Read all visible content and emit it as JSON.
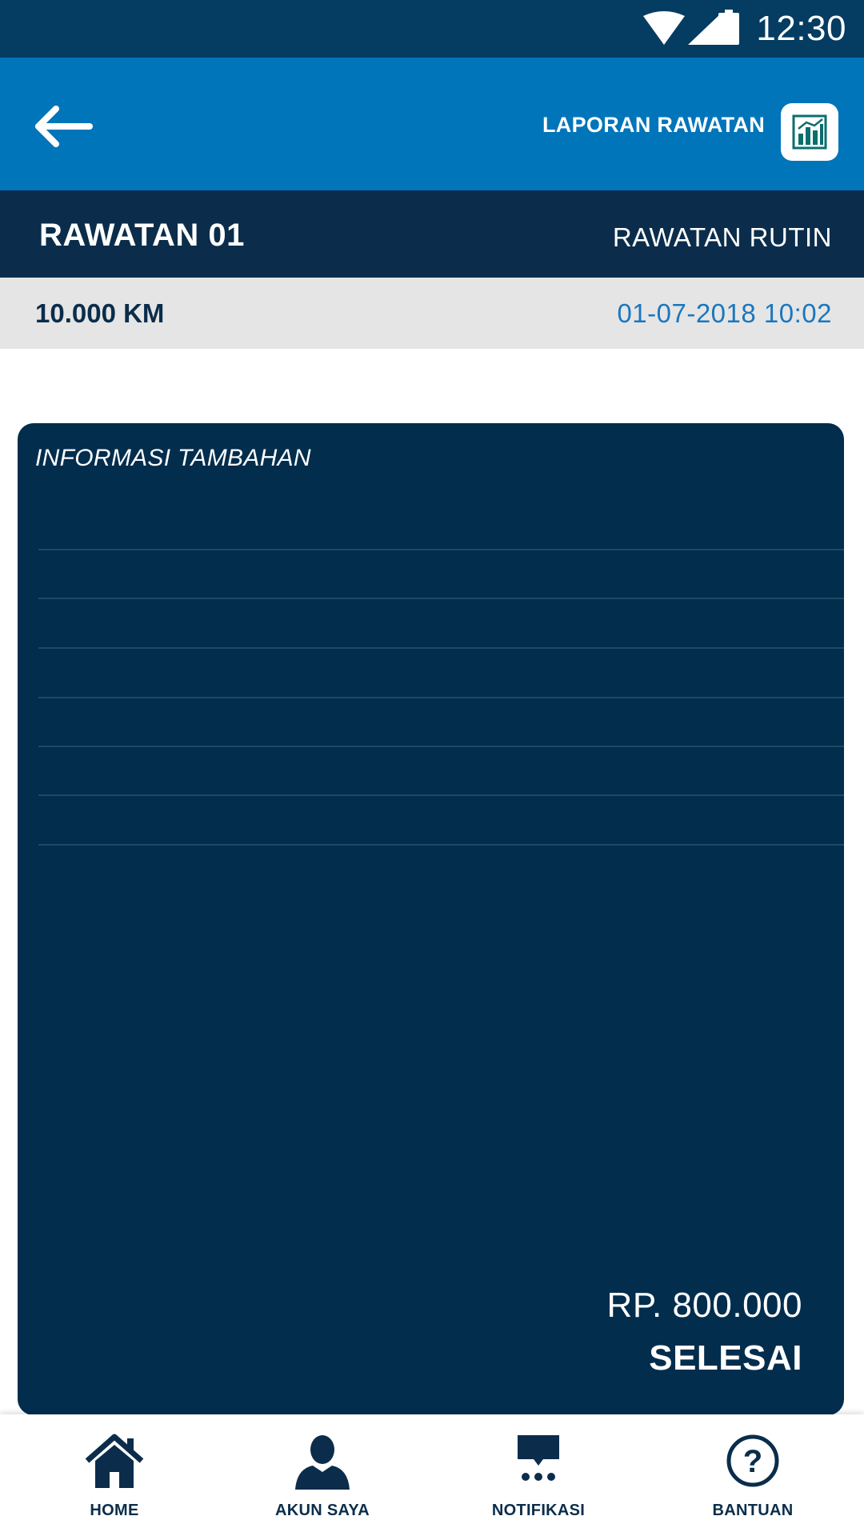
{
  "status_bar": {
    "time": "12:30"
  },
  "app_bar": {
    "report_label": "LAPORAN RAWATAN"
  },
  "header": {
    "title": "RAWATAN 01",
    "type": "RAWATAN RUTIN"
  },
  "info": {
    "mileage": "10.000 KM",
    "datetime": "01-07-2018 10:02"
  },
  "card": {
    "heading": "INFORMASI TAMBAHAN",
    "price": "RP. 800.000",
    "status": "SELESAI"
  },
  "bottom_nav": {
    "items": [
      {
        "label": "HOME",
        "icon": "home-icon"
      },
      {
        "label": "AKUN SAYA",
        "icon": "user-icon"
      },
      {
        "label": "NOTIFIKASI",
        "icon": "chat-icon"
      },
      {
        "label": "BANTUAN",
        "icon": "help-icon"
      }
    ]
  },
  "colors": {
    "status_bar": "#043c62",
    "app_bar": "#0075ba",
    "title_bar": "#0b2d4b",
    "card": "#022d4d",
    "date_accent": "#1a77be"
  }
}
